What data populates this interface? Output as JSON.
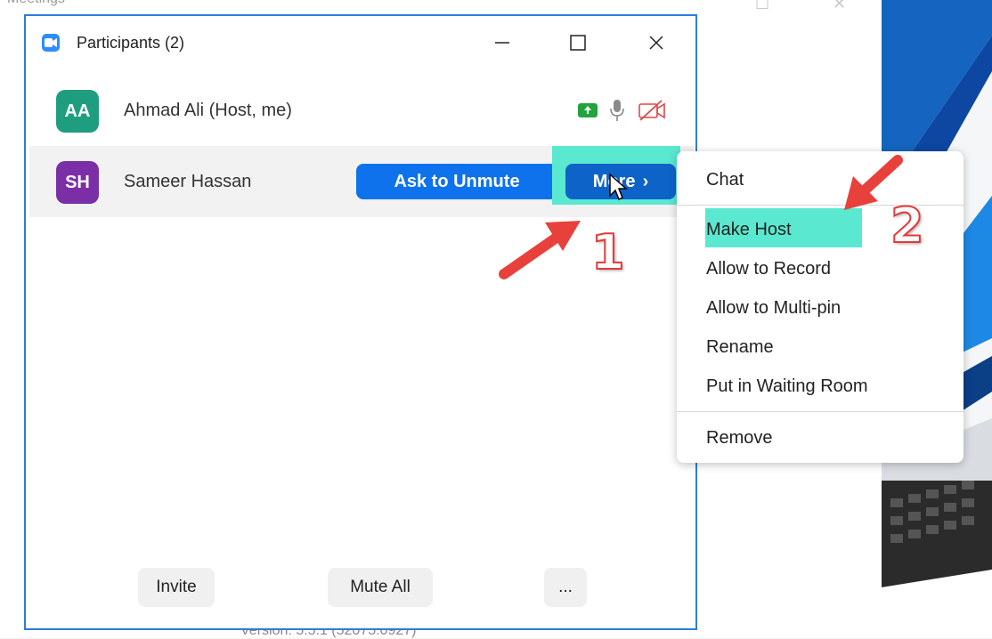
{
  "background": {
    "title": "Meetings",
    "footer": "Version: 5.5.1 (52075.0927)"
  },
  "window": {
    "title": "Participants (2)",
    "controls": {
      "minimize": "minimize-icon",
      "maximize": "maximize-icon",
      "close": "close-icon"
    }
  },
  "participants": [
    {
      "initials": "AA",
      "name": "Ahmad Ali (Host, me)",
      "avatar_color": "#1f9e7f",
      "icons": [
        "share-screen-icon",
        "microphone-icon",
        "video-off-icon"
      ]
    },
    {
      "initials": "SH",
      "name": "Sameer Hassan",
      "avatar_color": "#7b2fa6",
      "actions": {
        "ask_to_unmute": "Ask to Unmute",
        "more": "More"
      }
    }
  ],
  "footer": {
    "invite": "Invite",
    "mute_all": "Mute All",
    "more": "..."
  },
  "context_menu": {
    "items": [
      "Chat",
      "Make Host",
      "Allow to Record",
      "Allow to Multi-pin",
      "Rename",
      "Put in Waiting Room",
      "Remove"
    ],
    "highlighted": "Make Host"
  },
  "annotations": {
    "step1": "1",
    "step2": "2"
  },
  "colors": {
    "accent": "#0e72ed",
    "highlight": "#5ae8d0",
    "arrow": "#e8413c",
    "panel_border": "#2f7cd8"
  }
}
